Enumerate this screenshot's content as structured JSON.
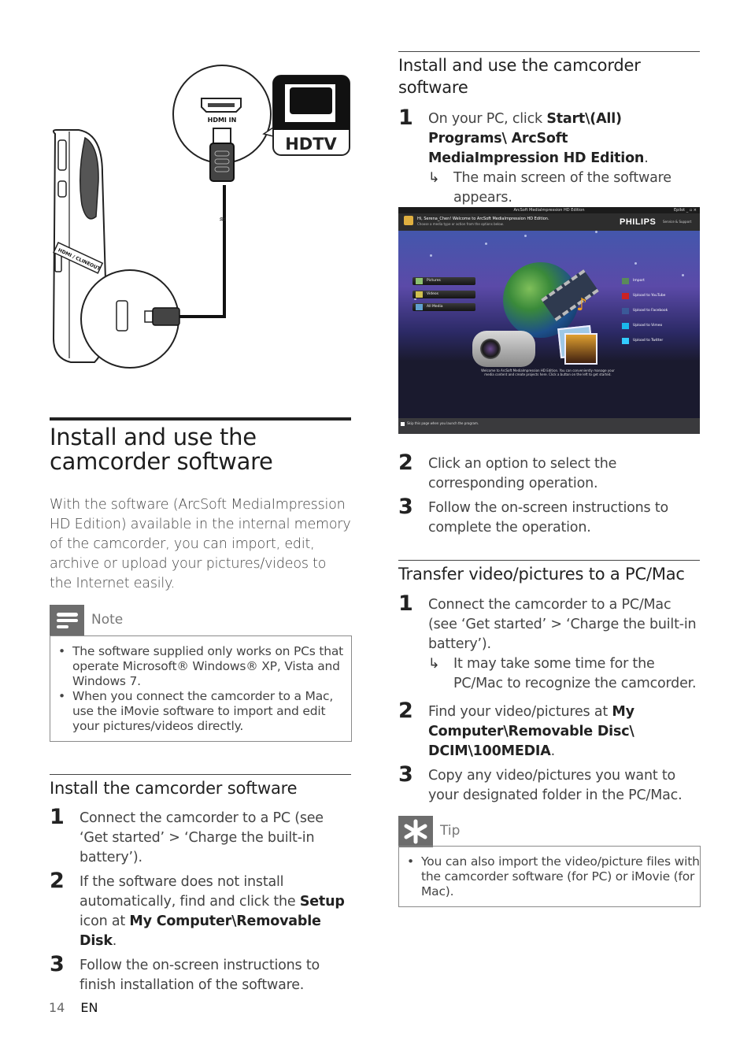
{
  "illustration": {
    "hdmi_in_label": "HDMI IN",
    "tv_label": "HDTV",
    "camcorder_port_label": "HDMI / CLINEOUT"
  },
  "left": {
    "title": "Install and use the camcorder software",
    "intro": "With the software (ArcSoft MediaImpression HD Edition) available in the internal memory of the camcorder, you can import, edit, archive or upload your pictures/videos to the Internet easily.",
    "note": {
      "icon": "note-icon",
      "label": "Note",
      "items": [
        "The software supplied only works on PCs that operate Microsoft® Windows® XP, Vista and Windows 7.",
        "When you connect the camcorder to a Mac, use the iMovie software to import and edit your pictures/videos directly."
      ]
    },
    "install_section": {
      "heading": "Install the camcorder software",
      "steps": [
        {
          "num": "1",
          "text": "Connect the camcorder to a PC (see ‘Get started’ > ‘Charge the built-in battery’)."
        },
        {
          "num": "2",
          "text_before": "If the software does not install automatically, find and click the ",
          "bold1": "Setup",
          "text_mid": " icon at ",
          "bold2": "My Computer\\Removable Disk",
          "text_after": "."
        },
        {
          "num": "3",
          "text": "Follow the on-screen instructions to finish installation of the software."
        }
      ]
    }
  },
  "right": {
    "use_section": {
      "heading": "Install and use the camcorder software",
      "step1": {
        "num": "1",
        "text_before": "On your PC, click ",
        "bold": "Start\\(All) Programs\\ ArcSoft MediaImpression HD Edition",
        "text_after": ".",
        "result": "The main screen of the software appears."
      },
      "step2": {
        "num": "2",
        "text": "Click an option to select the corresponding operation."
      },
      "step3": {
        "num": "3",
        "text": "Follow the on-screen instructions to complete the operation."
      }
    },
    "software_screen": {
      "window_title": "ArcSoft MediaImpression HD Edition",
      "window_controls": "Epilot _ ▫ ×",
      "greeting": "Hi, Serena_Chen! Welcome to ArcSoft MediaImpression HD Edition.",
      "subtext": "Choose a media type or action from the options below.",
      "brand": "PHILIPS",
      "support_link": "Service & Support",
      "nav": [
        "Pictures",
        "Videos",
        "All Media"
      ],
      "actions": [
        {
          "label": "Import",
          "icon": "import-icon",
          "color": "#5a8a5a"
        },
        {
          "label": "Upload to YouTube",
          "icon": "youtube-icon",
          "color": "#cc2222"
        },
        {
          "label": "Upload to Facebook",
          "icon": "facebook-icon",
          "color": "#3b5998"
        },
        {
          "label": "Upload to Vimeo",
          "icon": "vimeo-icon",
          "color": "#1ab7ea"
        },
        {
          "label": "Upload to Twitter",
          "icon": "twitter-icon",
          "color": "#33ccff"
        }
      ],
      "welcome_text": "Welcome to ArcSoft MediaImpression HD Edition. You can conveniently manage your media content and create projects here. Click a button on the left to get started.",
      "skip_label": "Skip this page when you launch the program."
    },
    "transfer_section": {
      "heading": "Transfer video/pictures to a PC/Mac",
      "step1": {
        "num": "1",
        "text": "Connect the camcorder to a PC/Mac (see ‘Get started’ > ‘Charge the built-in battery’).",
        "result": "It may take some time for the PC/Mac to recognize the camcorder."
      },
      "step2": {
        "num": "2",
        "text_before": "Find your video/pictures at ",
        "bold": "My Computer\\Removable Disc\\ DCIM\\100MEDIA",
        "text_after": "."
      },
      "step3": {
        "num": "3",
        "text": "Copy any video/pictures you want to your designated folder in the PC/Mac."
      }
    },
    "tip": {
      "icon": "tip-icon",
      "label": "Tip",
      "items": [
        "You can also import the video/picture files with the camcorder software (for PC) or iMovie (for Mac)."
      ]
    }
  },
  "footer": {
    "page_number": "14",
    "language": "EN"
  },
  "result_arrow": "↳"
}
